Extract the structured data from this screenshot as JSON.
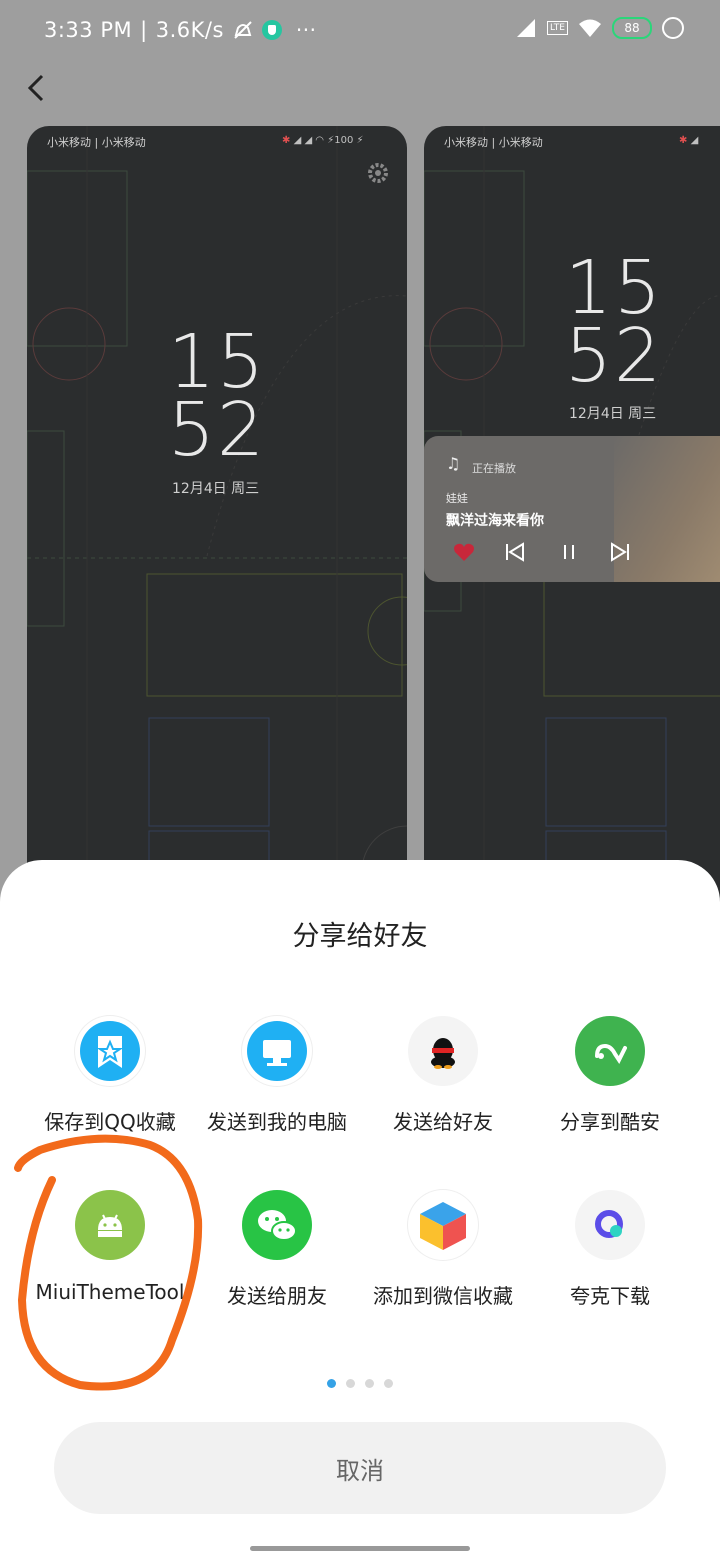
{
  "status_bar": {
    "time": "3:33 PM",
    "separator": "|",
    "net_speed": "3.6K/s",
    "battery": "88",
    "volte": "LTE",
    "more": "···"
  },
  "previews": [
    {
      "carrier": "小米移动 | 小米移动",
      "hour": "15",
      "minute": "52",
      "date": "12月4日 周三",
      "battery_text": "100"
    },
    {
      "carrier": "小米移动 | 小米移动",
      "hour": "15",
      "minute": "52",
      "date": "12月4日 周三",
      "music": {
        "status": "正在播放",
        "artist": "娃娃",
        "song": "飘洋过海来看你"
      }
    }
  ],
  "share_sheet": {
    "title": "分享给好友",
    "items": [
      {
        "label": "保存到QQ收藏",
        "icon": "qq-favorite-icon"
      },
      {
        "label": "发送到我的电脑",
        "icon": "my-computer-icon"
      },
      {
        "label": "发送给好友",
        "icon": "qq-penguin-icon"
      },
      {
        "label": "分享到酷安",
        "icon": "coolapk-icon"
      },
      {
        "label": "MiuiThemeTool",
        "icon": "android-icon"
      },
      {
        "label": "发送给朋友",
        "icon": "wechat-icon"
      },
      {
        "label": "添加到微信收藏",
        "icon": "wechat-favorite-cube-icon"
      },
      {
        "label": "夸克下载",
        "icon": "quark-icon"
      }
    ],
    "page_count": 4,
    "current_page": 1,
    "cancel_label": "取消"
  },
  "colors": {
    "accent": "#35a2e6",
    "annotation": "#f26a1b",
    "qq_blue": "#1fb0f3",
    "coolapk_green": "#3fb34f",
    "android_green": "#8bc34a",
    "wechat_green": "#28c445"
  }
}
